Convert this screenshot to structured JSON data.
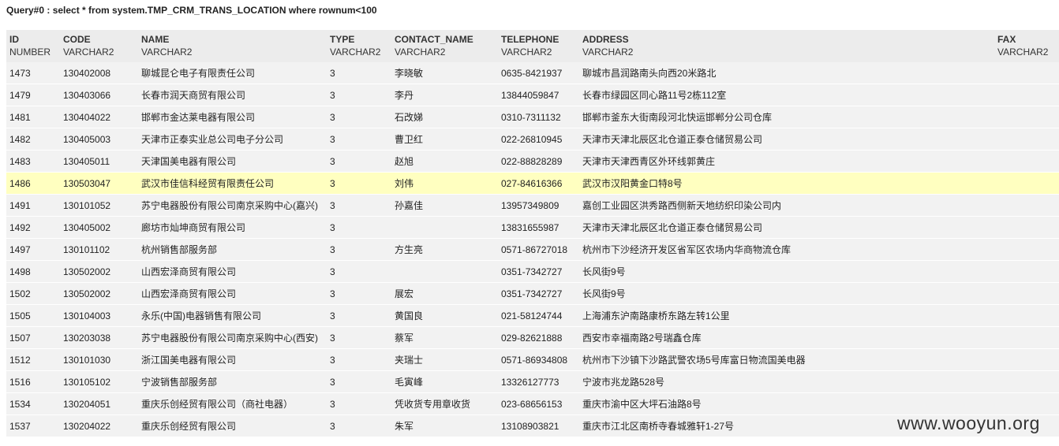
{
  "query": "Query#0 : select * from system.TMP_CRM_TRANS_LOCATION where rownum<100",
  "columns": [
    {
      "name": "ID",
      "type": "NUMBER"
    },
    {
      "name": "CODE",
      "type": "VARCHAR2"
    },
    {
      "name": "NAME",
      "type": "VARCHAR2"
    },
    {
      "name": "TYPE",
      "type": "VARCHAR2"
    },
    {
      "name": "CONTACT_NAME",
      "type": "VARCHAR2"
    },
    {
      "name": "TELEPHONE",
      "type": "VARCHAR2"
    },
    {
      "name": "ADDRESS",
      "type": "VARCHAR2"
    },
    {
      "name": "FAX",
      "type": "VARCHAR2"
    }
  ],
  "rows": [
    {
      "id": "1473",
      "code": "130402008",
      "name": "聊城昆仑电子有限责任公司",
      "type": "3",
      "contact": "李晓敏",
      "tel": "0635-8421937",
      "address": "聊城市昌润路南头向西20米路北",
      "fax": ""
    },
    {
      "id": "1479",
      "code": "130403066",
      "name": "长春市润天商贸有限公司",
      "type": "3",
      "contact": "李丹",
      "tel": "13844059847",
      "address": "长春市绿园区同心路11号2栋112室",
      "fax": ""
    },
    {
      "id": "1481",
      "code": "130404022",
      "name": "邯郸市金达莱电器有限公司",
      "type": "3",
      "contact": "石改娣",
      "tel": "0310-7311132",
      "address": "邯郸市釜东大街南段河北快运邯郸分公司仓库",
      "fax": ""
    },
    {
      "id": "1482",
      "code": "130405003",
      "name": "天津市正泰实业总公司电子分公司",
      "type": "3",
      "contact": "曹卫红",
      "tel": "022-26810945",
      "address": "天津市天津北辰区北仓道正泰仓储贸易公司",
      "fax": ""
    },
    {
      "id": "1483",
      "code": "130405011",
      "name": "天津国美电器有限公司",
      "type": "3",
      "contact": "赵旭",
      "tel": "022-88828289",
      "address": "天津市天津西青区外环线郭黄庄",
      "fax": ""
    },
    {
      "id": "1486",
      "code": "130503047",
      "name": "武汉市佳信科经贸有限责任公司",
      "type": "3",
      "contact": "刘伟",
      "tel": "027-84616366",
      "address": "武汉市汉阳黄金口特8号",
      "fax": ""
    },
    {
      "id": "1491",
      "code": "130101052",
      "name": "苏宁电器股份有限公司南京采购中心(嘉兴)",
      "type": "3",
      "contact": "孙嘉佳",
      "tel": "13957349809",
      "address": "嘉创工业园区洪秀路西侧新天地纺织印染公司内",
      "fax": ""
    },
    {
      "id": "1492",
      "code": "130405002",
      "name": "廊坊市灿坤商贸有限公司",
      "type": "3",
      "contact": "",
      "tel": "13831655987",
      "address": "天津市天津北辰区北仓道正泰仓储贸易公司",
      "fax": ""
    },
    {
      "id": "1497",
      "code": "130101102",
      "name": "杭州销售部服务部",
      "type": "3",
      "contact": "方生亮",
      "tel": "0571-86727018",
      "address": "杭州市下沙经济开发区省军区农场内华商物流仓库",
      "fax": ""
    },
    {
      "id": "1498",
      "code": "130502002",
      "name": "山西宏泽商贸有限公司",
      "type": "3",
      "contact": "",
      "tel": "0351-7342727",
      "address": "长风街9号",
      "fax": ""
    },
    {
      "id": "1502",
      "code": "130502002",
      "name": "山西宏泽商贸有限公司",
      "type": "3",
      "contact": "展宏",
      "tel": "0351-7342727",
      "address": "长风街9号",
      "fax": ""
    },
    {
      "id": "1505",
      "code": "130104003",
      "name": "永乐(中国)电器销售有限公司",
      "type": "3",
      "contact": "黄国良",
      "tel": "021-58124744",
      "address": "上海浦东沪南路康桥东路左转1公里",
      "fax": ""
    },
    {
      "id": "1507",
      "code": "130203038",
      "name": "苏宁电器股份有限公司南京采购中心(西安)",
      "type": "3",
      "contact": "蔡军",
      "tel": "029-82621888",
      "address": "西安市幸福南路2号瑞鑫仓库",
      "fax": ""
    },
    {
      "id": "1512",
      "code": "130101030",
      "name": "浙江国美电器有限公司",
      "type": "3",
      "contact": "夹瑞士",
      "tel": "0571-86934808",
      "address": "杭州市下沙镇下沙路武警农场5号库富日物流国美电器",
      "fax": ""
    },
    {
      "id": "1516",
      "code": "130105102",
      "name": "宁波销售部服务部",
      "type": "3",
      "contact": "毛寅峰",
      "tel": "13326127773",
      "address": "宁波市兆龙路528号",
      "fax": ""
    },
    {
      "id": "1534",
      "code": "130204051",
      "name": "重庆乐创经贸有限公司（商社电器）",
      "type": "3",
      "contact": "凭收货专用章收货",
      "tel": "023-68656153",
      "address": "重庆市渝中区大坪石油路8号",
      "fax": ""
    },
    {
      "id": "1537",
      "code": "130204022",
      "name": "重庆乐创经贸有限公司",
      "type": "3",
      "contact": "朱军",
      "tel": "13108903821",
      "address": "重庆市江北区南桥寺春城雅轩1-27号",
      "fax": ""
    }
  ],
  "selected_row_index": 5,
  "colors": {
    "selected_row": "#ffffc0",
    "row_bg": "#f2f2f2",
    "header_bg": "#ececec"
  },
  "watermark": "www.wooyun.org"
}
